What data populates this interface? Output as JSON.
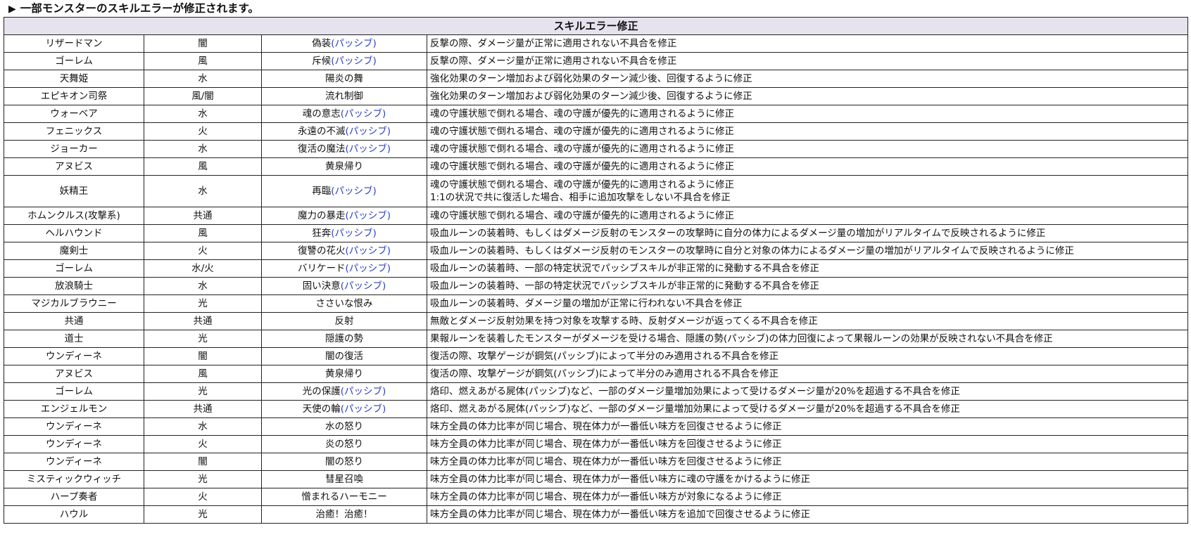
{
  "heading": {
    "bullet": "▶",
    "text": "一部モンスターのスキルエラーが修正されます。"
  },
  "table": {
    "title": "スキルエラー修正",
    "rows": [
      {
        "monster": "リザードマン",
        "attr": "闇",
        "skill": "偽装",
        "tag": "(パッシブ)",
        "desc": [
          "反撃の際、ダメージ量が正常に適用されない不具合を修正"
        ]
      },
      {
        "monster": "ゴーレム",
        "attr": "風",
        "skill": "斥候",
        "tag": "(パッシブ)",
        "desc": [
          "反撃の際、ダメージ量が正常に適用されない不具合を修正"
        ]
      },
      {
        "monster": "天舞姫",
        "attr": "水",
        "skill": "陽炎の舞",
        "tag": "",
        "desc": [
          "強化効果のターン増加および弱化効果のターン減少後、回復するように修正"
        ]
      },
      {
        "monster": "エピキオン司祭",
        "attr": "風/闇",
        "skill": "流れ制御",
        "tag": "",
        "desc": [
          "強化効果のターン増加および弱化効果のターン減少後、回復するように修正"
        ]
      },
      {
        "monster": "ウォーベア",
        "attr": "水",
        "skill": "魂の意志",
        "tag": "(パッシブ)",
        "desc": [
          "魂の守護状態で倒れる場合、魂の守護が優先的に適用されるように修正"
        ]
      },
      {
        "monster": "フェニックス",
        "attr": "火",
        "skill": "永遠の不滅",
        "tag": "(パッシブ)",
        "desc": [
          "魂の守護状態で倒れる場合、魂の守護が優先的に適用されるように修正"
        ]
      },
      {
        "monster": "ジョーカー",
        "attr": "水",
        "skill": "復活の魔法",
        "tag": "(パッシブ)",
        "desc": [
          "魂の守護状態で倒れる場合、魂の守護が優先的に適用されるように修正"
        ]
      },
      {
        "monster": "アヌビス",
        "attr": "風",
        "skill": "黄泉帰り",
        "tag": "",
        "desc": [
          "魂の守護状態で倒れる場合、魂の守護が優先的に適用されるように修正"
        ]
      },
      {
        "monster": "妖精王",
        "attr": "水",
        "skill": "再臨",
        "tag": "(パッシブ)",
        "desc": [
          "魂の守護状態で倒れる場合、魂の守護が優先的に適用されるように修正",
          "1:1の状況で共に復活した場合、相手に追加攻撃をしない不具合を修正"
        ]
      },
      {
        "monster": "ホムンクルス(攻撃系)",
        "attr": "共通",
        "skill": "魔力の暴走",
        "tag": "(パッシブ)",
        "desc": [
          "魂の守護状態で倒れる場合、魂の守護が優先的に適用されるように修正"
        ]
      },
      {
        "monster": "ヘルハウンド",
        "attr": "風",
        "skill": "狂奔",
        "tag": "(パッシブ)",
        "desc": [
          "吸血ルーンの装着時、もしくはダメージ反射のモンスターの攻撃時に自分の体力によるダメージ量の増加がリアルタイムで反映されるように修正"
        ]
      },
      {
        "monster": "魔剣士",
        "attr": "火",
        "skill": "復讐の花火",
        "tag": "(パッシブ)",
        "desc": [
          "吸血ルーンの装着時、もしくはダメージ反射のモンスターの攻撃時に自分と対象の体力によるダメージ量の増加がリアルタイムで反映されるように修正"
        ]
      },
      {
        "monster": "ゴーレム",
        "attr": "水/火",
        "skill": "バリケード",
        "tag": "(パッシブ)",
        "desc": [
          "吸血ルーンの装着時、一部の特定状況でパッシブスキルが非正常的に発動する不具合を修正"
        ]
      },
      {
        "monster": "放浪騎士",
        "attr": "水",
        "skill": "固い決意",
        "tag": "(パッシブ)",
        "desc": [
          "吸血ルーンの装着時、一部の特定状況でパッシブスキルが非正常的に発動する不具合を修正"
        ]
      },
      {
        "monster": "マジカルブラウニー",
        "attr": "光",
        "skill": "ささいな恨み",
        "tag": "",
        "desc": [
          "吸血ルーンの装着時、ダメージ量の増加が正常に行われない不具合を修正"
        ]
      },
      {
        "monster": "共通",
        "attr": "共通",
        "skill": "反射",
        "tag": "",
        "desc": [
          "無敵とダメージ反射効果を持つ対象を攻撃する時、反射ダメージが返ってくる不具合を修正"
        ]
      },
      {
        "monster": "道士",
        "attr": "光",
        "skill": "隠護の勢",
        "tag": "",
        "desc": [
          "果報ルーンを装着したモンスターがダメージを受ける場合、隠護の勢(パッシブ)の体力回復によって果報ルーンの効果が反映されない不具合を修正"
        ]
      },
      {
        "monster": "ウンディーネ",
        "attr": "闇",
        "skill": "闇の復活",
        "tag": "",
        "desc": [
          "復活の際、攻撃ゲージが鋼気(パッシブ)によって半分のみ適用される不具合を修正"
        ]
      },
      {
        "monster": "アヌビス",
        "attr": "風",
        "skill": "黄泉帰り",
        "tag": "",
        "desc": [
          "復活の際、攻撃ゲージが鋼気(パッシブ)によって半分のみ適用される不具合を修正"
        ]
      },
      {
        "monster": "ゴーレム",
        "attr": "光",
        "skill": "光の保護",
        "tag": "(パッシブ)",
        "desc": [
          "烙印、燃えあがる屍体(パッシブ)など、一部のダメージ量増加効果によって受けるダメージ量が20%を超過する不具合を修正"
        ]
      },
      {
        "monster": "エンジェルモン",
        "attr": "共通",
        "skill": "天使の輪",
        "tag": "(パッシブ)",
        "desc": [
          "烙印、燃えあがる屍体(パッシブ)など、一部のダメージ量増加効果によって受けるダメージ量が20%を超過する不具合を修正"
        ]
      },
      {
        "monster": "ウンディーネ",
        "attr": "水",
        "skill": "水の怒り",
        "tag": "",
        "desc": [
          "味方全員の体力比率が同じ場合、現在体力が一番低い味方を回復させるように修正"
        ]
      },
      {
        "monster": "ウンディーネ",
        "attr": "火",
        "skill": "炎の怒り",
        "tag": "",
        "desc": [
          "味方全員の体力比率が同じ場合、現在体力が一番低い味方を回復させるように修正"
        ]
      },
      {
        "monster": "ウンディーネ",
        "attr": "闇",
        "skill": "闇の怒り",
        "tag": "",
        "desc": [
          "味方全員の体力比率が同じ場合、現在体力が一番低い味方を回復させるように修正"
        ]
      },
      {
        "monster": "ミスティックウィッチ",
        "attr": "光",
        "skill": "彗星召喚",
        "tag": "",
        "desc": [
          "味方全員の体力比率が同じ場合、現在体力が一番低い味方に魂の守護をかけるように修正"
        ]
      },
      {
        "monster": "ハープ奏者",
        "attr": "火",
        "skill": "憎まれるハーモニー",
        "tag": "",
        "desc": [
          "味方全員の体力比率が同じ場合、現在体力が一番低い味方が対象になるように修正"
        ]
      },
      {
        "monster": "ハウル",
        "attr": "光",
        "skill": "治癒！治癒！",
        "tag": "",
        "desc": [
          "味方全員の体力比率が同じ場合、現在体力が一番低い味方を追加で回復させるように修正"
        ]
      }
    ]
  }
}
